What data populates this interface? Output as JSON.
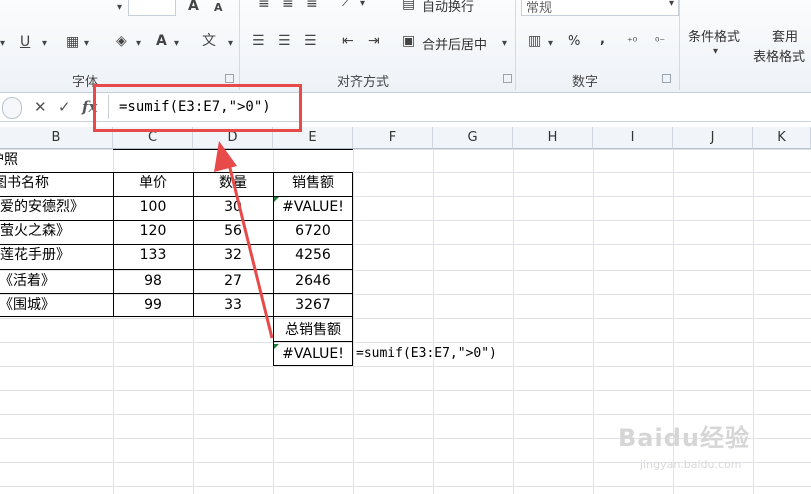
{
  "ribbon": {
    "wrap_text": "自动换行",
    "merge_center": "合并后居中",
    "number_format": "常规",
    "percent": "%",
    "comma": ",",
    "cond_format": "条件格式",
    "table_format_top": "套用",
    "table_format_bottom": "表格格式",
    "groups": {
      "font": "字体",
      "align": "对齐方式",
      "number": "数字"
    }
  },
  "formula_bar": {
    "cancel": "✕",
    "enter": "✓",
    "fx": "fx",
    "content": "=sumif(E3:E7,\">0\")"
  },
  "columns": [
    "B",
    "C",
    "D",
    "E",
    "F",
    "G",
    "H",
    "I",
    "J",
    "K"
  ],
  "rows": {
    "r1": {
      "b": "护照"
    },
    "r2": {
      "b": "图书名称",
      "c": "单价",
      "d": "数量",
      "e": "销售额"
    },
    "data": [
      {
        "b": "《爱的安德烈》",
        "c": "100",
        "d": "30",
        "e": "#VALUE!"
      },
      {
        "b": "《萤火之森》",
        "c": "120",
        "d": "56",
        "e": "6720"
      },
      {
        "b": "《莲花手册》",
        "c": "133",
        "d": "32",
        "e": "4256"
      },
      {
        "b": "《活着》",
        "c": "98",
        "d": "27",
        "e": "2646"
      },
      {
        "b": "《围城》",
        "c": "99",
        "d": "33",
        "e": "3267"
      }
    ],
    "total_label": "总销售额",
    "total_value": "#VALUE!",
    "formula_note": "=sumif(E3:E7,\">0\")"
  },
  "watermark": {
    "logo": "Baidu经验",
    "url": "jingyan.baidu.com"
  },
  "colors": {
    "annotation": "#e84a4a",
    "error_flag": "#1e7d3a"
  }
}
